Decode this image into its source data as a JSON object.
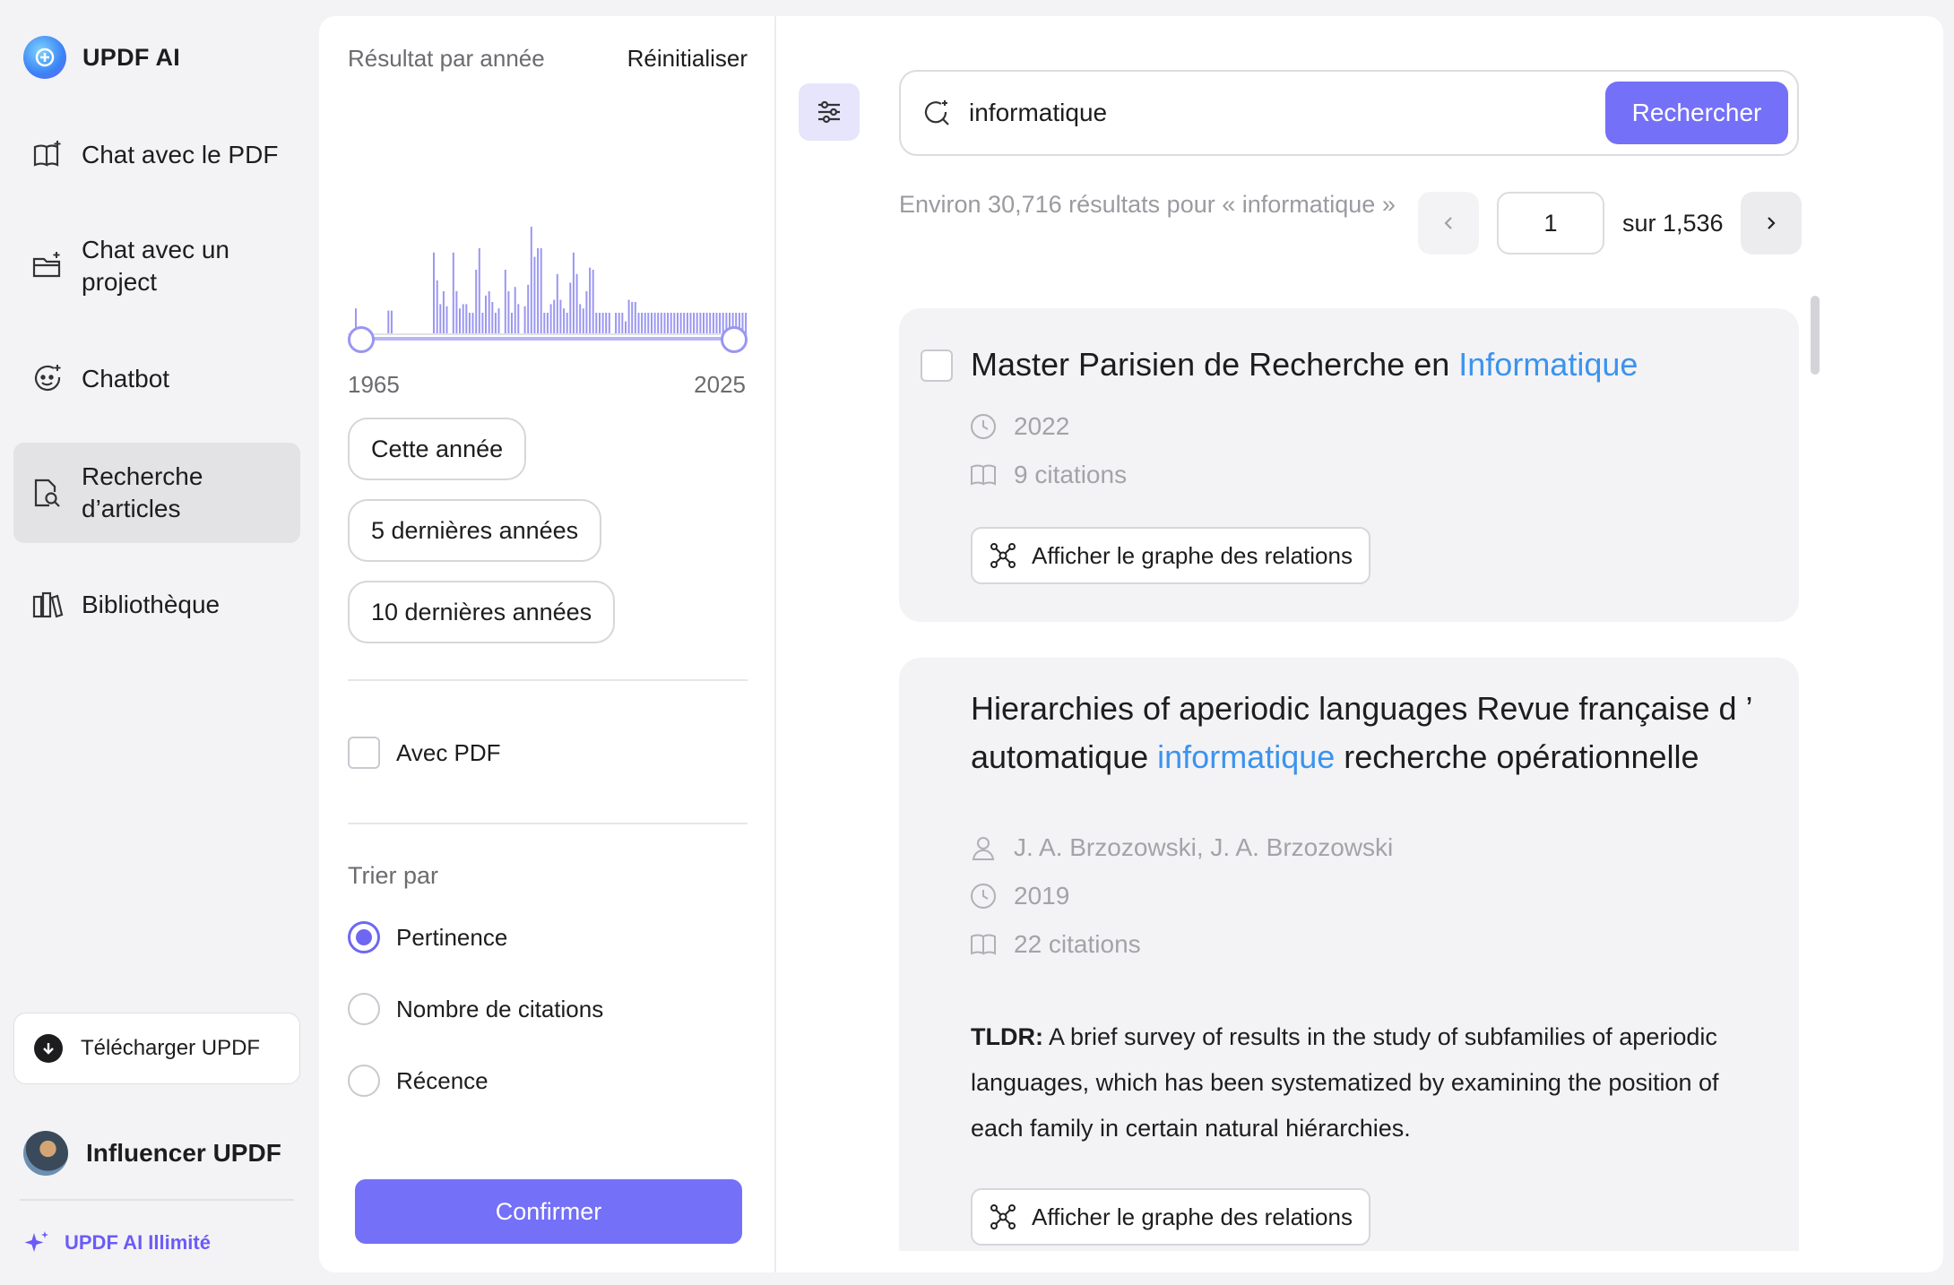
{
  "app": {
    "name": "UPDF AI"
  },
  "sidebar": {
    "items": [
      {
        "label": "Chat avec le PDF",
        "icon": "book-sparkle-icon"
      },
      {
        "label": "Chat avec un project",
        "icon": "folder-sparkle-icon"
      },
      {
        "label": "Chatbot",
        "icon": "bot-face-icon"
      },
      {
        "label": "Recherche d’articles",
        "icon": "doc-search-icon",
        "active": true
      },
      {
        "label": "Bibliothèque",
        "icon": "library-icon"
      }
    ],
    "download_label": "Télécharger UPDF",
    "user_name": "Influencer UPDF",
    "unlimited_label": "UPDF AI Illimité"
  },
  "filter": {
    "title": "Résultat par année",
    "reset": "Réinitialiser",
    "year_min": "1965",
    "year_max": "2025",
    "year_buttons": [
      "Cette année",
      "5 dernières années",
      "10 dernières années"
    ],
    "with_pdf": "Avec PDF",
    "sort_label": "Trier par",
    "sort_options": [
      {
        "label": "Pertinence",
        "selected": true
      },
      {
        "label": "Nombre de citations",
        "selected": false
      },
      {
        "label": "Récence",
        "selected": false
      }
    ],
    "confirm": "Confirmer"
  },
  "chart_data": {
    "type": "bar",
    "title": "",
    "x_range": [
      "1965",
      "2025"
    ],
    "values": [
      0.12,
      0,
      0,
      0,
      0,
      0,
      0,
      0,
      0,
      0,
      0.11,
      0.11,
      0,
      0,
      0,
      0,
      0,
      0,
      0,
      0,
      0,
      0,
      0,
      0,
      0.38,
      0.25,
      0.14,
      0.2,
      0.13,
      0,
      0.38,
      0.2,
      0.12,
      0.14,
      0.14,
      0.1,
      0.1,
      0.3,
      0.4,
      0.1,
      0.18,
      0.2,
      0.15,
      0.1,
      0.12,
      0,
      0.3,
      0.2,
      0.1,
      0.22,
      0.14,
      0,
      0.13,
      0.23,
      0.5,
      0.36,
      0.4,
      0.4,
      0.1,
      0.1,
      0.14,
      0.16,
      0.28,
      0.16,
      0.12,
      0.1,
      0.24,
      0.38,
      0.28,
      0.14,
      0.12,
      0.2,
      0.31,
      0.3,
      0.1,
      0.1,
      0.1,
      0.1,
      0.1,
      0,
      0.1,
      0.1,
      0.1,
      0.06,
      0.16,
      0.15,
      0.15,
      0.1,
      0.1,
      0.1,
      0.1,
      0.1,
      0.1,
      0.1,
      0.1,
      0.1,
      0.1,
      0.1,
      0.1,
      0.1,
      0.1,
      0.1,
      0.1,
      0.1,
      0.1,
      0.1,
      0.1,
      0.1,
      0.1,
      0.1,
      0.1,
      0.1,
      0.1,
      0.1,
      0.1,
      0.1,
      0.1,
      0.1,
      0.1,
      0.1,
      0.1,
      0.1,
      0.1
    ],
    "color": "#9b97f2"
  },
  "search": {
    "query": "informatique",
    "button": "Rechercher"
  },
  "results_summary": "Environ 30,716 résultats pour « informatique »",
  "pagination": {
    "current": "1",
    "total": "sur 1,536"
  },
  "results": [
    {
      "title_pre": "Master Parisien de Recherche en ",
      "title_hl": "Informatique",
      "title_post": "",
      "year": "2022",
      "citations": "9 citations",
      "graph_button": "Afficher le graphe des relations"
    },
    {
      "title_pre": "Hierarchies of aperiodic languages Revue française d ’ automatique ",
      "title_hl": "informatique",
      "title_post": " recherche opérationnelle",
      "authors": "J. A. Brzozowski,  J. A. Brzozowski",
      "year": "2019",
      "citations": "22 citations",
      "tldr_label": "TLDR:",
      "tldr": " A brief survey of results in the study of subfamilies of aperiodic languages, which has been systematized by examining the position of each family in certain natural hiérarchies.",
      "graph_button": "Afficher le graphe des relations"
    }
  ],
  "colors": {
    "accent": "#7470f7",
    "highlight": "#3b93ee"
  }
}
